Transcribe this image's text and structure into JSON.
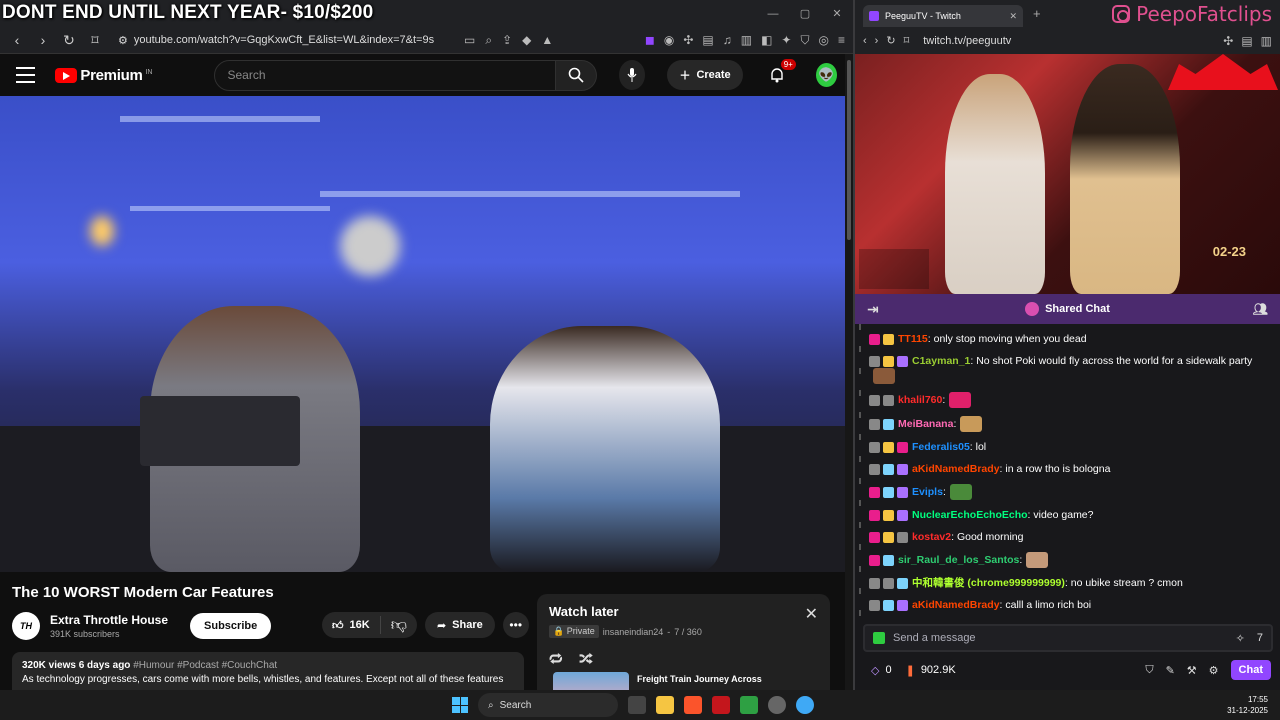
{
  "overlay": {
    "title": "DONT END UNTIL NEXT YEAR- $10/$200",
    "brand": "PeepoFatclips"
  },
  "left_browser": {
    "url": "youtube.com/watch?v=GqgKxwCft_E&list=WL&index=7&t=9s",
    "window_controls": {
      "minimize": "—",
      "maximize": "▢",
      "close": "✕"
    }
  },
  "youtube": {
    "logo_text": "Premium",
    "logo_region": "IN",
    "search_placeholder": "Search",
    "create_label": "Create",
    "notif_count": "9+",
    "video": {
      "title": "The 10 WORST Modern Car Features",
      "channel": "Extra Throttle House",
      "channel_avatar_text": "TH",
      "subscribers": "391K subscribers",
      "subscribe_label": "Subscribe",
      "likes": "16K",
      "share_label": "Share",
      "views": "320K views",
      "age": "6 days ago",
      "tags": "#Humour #Podcast #CouchChat",
      "description": "As technology progresses, cars come with more bells, whistles, and features. Except not all of these features"
    },
    "watch_later": {
      "title": "Watch later",
      "privacy": "Private",
      "owner": "insaneindian24",
      "position": "7 / 360",
      "next_item_title": "Freight Train Journey Across"
    }
  },
  "right_browser": {
    "tab_title": "PeeguuTV - Twitch",
    "url": "twitch.tv/peeguutv",
    "stream_sign": "02-23"
  },
  "chat": {
    "header": "Shared Chat",
    "messages": [
      {
        "user": "TT115",
        "color": "#ff4500",
        "text": ": only stop moving when you dead",
        "badges": [
          "b-pink",
          "b-gold"
        ]
      },
      {
        "user": "C1ayman_1",
        "color": "#9acd32",
        "text": ": No shot Poki would fly across the world for a sidewalk party",
        "badges": [
          "b-gray",
          "b-gold",
          "b-purple"
        ],
        "emote": "#8a5a3a"
      },
      {
        "user": "khalil760",
        "color": "#ff2b2b",
        "text": ":",
        "badges": [
          "b-gray",
          "b-gray"
        ],
        "emote": "#e0206a"
      },
      {
        "user": "MeiBanana",
        "color": "#ff69b4",
        "text": ":",
        "badges": [
          "b-gray",
          "b-blue"
        ],
        "emote": "#c89a5a"
      },
      {
        "user": "Federalis05",
        "color": "#1e90ff",
        "text": ": lol",
        "badges": [
          "b-gray",
          "b-gold",
          "b-pink"
        ]
      },
      {
        "user": "aKidNamedBrady",
        "color": "#ff4500",
        "text": ": in a row tho is bologna",
        "badges": [
          "b-gray",
          "b-blue",
          "b-purple"
        ]
      },
      {
        "user": "Evipls",
        "color": "#1e90ff",
        "text": ":",
        "badges": [
          "b-pink",
          "b-blue",
          "b-purple"
        ],
        "emote": "#4a8a3a"
      },
      {
        "user": "NuclearEchoEchoEcho",
        "color": "#00ff7f",
        "text": ": video game?",
        "badges": [
          "b-pink",
          "b-gold",
          "b-purple"
        ]
      },
      {
        "user": "kostav2",
        "color": "#ff2b2b",
        "text": ": Good morning",
        "badges": [
          "b-pink",
          "b-gold",
          "b-gray"
        ]
      },
      {
        "user": "sir_Raul_de_los_Santos",
        "color": "#2ecc71",
        "text": ":",
        "badges": [
          "b-pink",
          "b-blue"
        ],
        "emote": "#c49a7a"
      },
      {
        "user": "中和韓書俊 (chrome999999999)",
        "color": "#adff2f",
        "text": ": no ubike stream ? cmon",
        "badges": [
          "b-gray",
          "b-gray",
          "b-blue"
        ]
      },
      {
        "user": "aKidNamedBrady",
        "color": "#ff4500",
        "text": ": calll a limo rich boi",
        "badges": [
          "b-gray",
          "b-blue",
          "b-purple"
        ]
      }
    ],
    "input_placeholder": "Send a message",
    "points": "0",
    "bits": "902.9K",
    "chat_button": "Chat"
  },
  "taskbar": {
    "search_label": "Search",
    "time": "17:55",
    "date": "31-12-2025"
  }
}
